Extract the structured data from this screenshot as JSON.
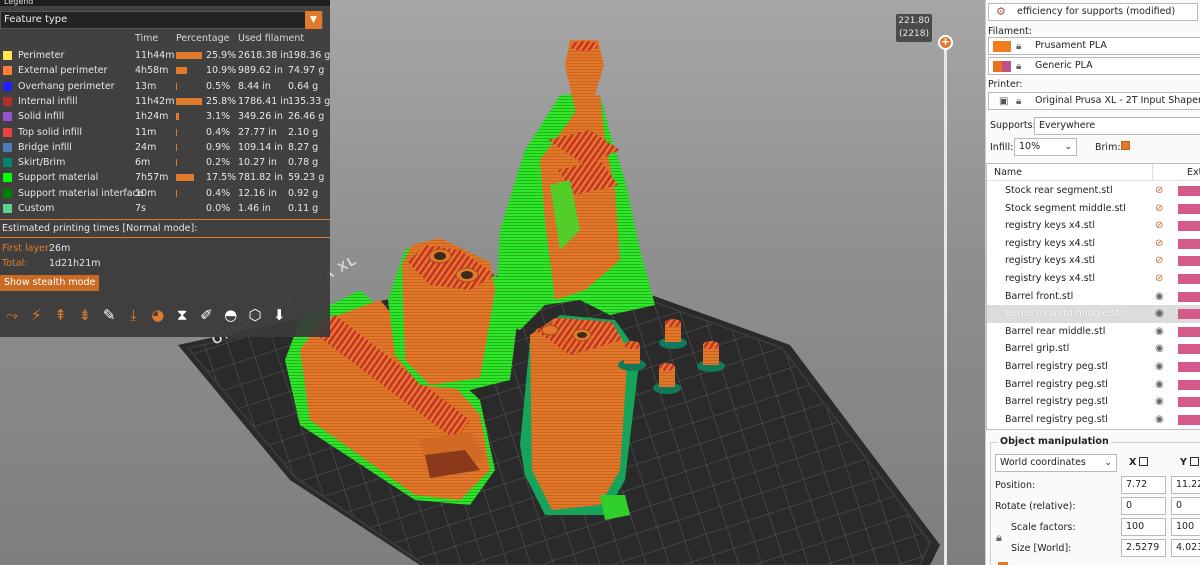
{
  "legend": {
    "title": "Legend",
    "view_type": "Feature type",
    "headers": {
      "time": "Time",
      "percentage": "Percentage",
      "used_filament": "Used filament"
    },
    "rows": [
      {
        "name": "Perimeter",
        "color": "#ffe64d",
        "time": "11h44m",
        "pct": "25.9%",
        "pct_value": 25.9,
        "length": "2618.38 in",
        "weight": "198.36 g"
      },
      {
        "name": "External perimeter",
        "color": "#ff7d38",
        "time": "4h58m",
        "pct": "10.9%",
        "pct_value": 10.9,
        "length": "989.62 in",
        "weight": "74.97 g"
      },
      {
        "name": "Overhang perimeter",
        "color": "#1f1fff",
        "time": "13m",
        "pct": "0.5%",
        "pct_value": 0.5,
        "length": "8.44 in",
        "weight": "0.64 g"
      },
      {
        "name": "Internal infill",
        "color": "#b03029",
        "time": "11h42m",
        "pct": "25.8%",
        "pct_value": 25.8,
        "length": "1786.41 in",
        "weight": "135.33 g"
      },
      {
        "name": "Solid infill",
        "color": "#9654cc",
        "time": "1h24m",
        "pct": "3.1%",
        "pct_value": 3.1,
        "length": "349.26 in",
        "weight": "26.46 g"
      },
      {
        "name": "Top solid infill",
        "color": "#f04040",
        "time": "11m",
        "pct": "0.4%",
        "pct_value": 0.4,
        "length": "27.77 in",
        "weight": "2.10 g"
      },
      {
        "name": "Bridge infill",
        "color": "#4d80ba",
        "time": "24m",
        "pct": "0.9%",
        "pct_value": 0.9,
        "length": "109.14 in",
        "weight": "8.27 g"
      },
      {
        "name": "Skirt/Brim",
        "color": "#00876e",
        "time": "6m",
        "pct": "0.2%",
        "pct_value": 0.2,
        "length": "10.27 in",
        "weight": "0.78 g"
      },
      {
        "name": "Support material",
        "color": "#00ff00",
        "time": "7h57m",
        "pct": "17.5%",
        "pct_value": 17.5,
        "length": "781.82 in",
        "weight": "59.23 g"
      },
      {
        "name": "Support material interface",
        "color": "#008000",
        "time": "10m",
        "pct": "0.4%",
        "pct_value": 0.4,
        "length": "12.16 in",
        "weight": "0.92 g"
      },
      {
        "name": "Custom",
        "color": "#5ed194",
        "time": "7s",
        "pct": "0.0%",
        "pct_value": 0.0,
        "length": "1.46 in",
        "weight": "0.11 g"
      }
    ],
    "estimated_label": "Estimated printing times [Normal mode]:",
    "first_layer_label": "First layer:",
    "first_layer_value": "26m",
    "total_label": "Total:",
    "total_value": "1d21h21m",
    "stealth_button": "Show stealth mode",
    "toolbar_icons": [
      "travel-icon",
      "wipe-icon",
      "retractions-icon",
      "deretractions-icon",
      "seams-icon",
      "tool-changes-icon",
      "color-changes-icon",
      "pause-icon",
      "custom-gcode-icon",
      "center-of-gravity-icon",
      "shells-icon",
      "tool-marker-icon"
    ]
  },
  "slider": {
    "height_value": "221.80",
    "layer_value": "(2218)",
    "thumb_symbol": "+"
  },
  "bed_label": "ORIGINAL PRUSA XL",
  "sidebar": {
    "print_settings": "efficiency for supports (modified)",
    "filament_label": "Filament:",
    "filaments": [
      {
        "name": "Prusament PLA",
        "color": "#f07d1e"
      },
      {
        "name": "Generic PLA",
        "color": "#e6721e",
        "accent": "#c0508a"
      }
    ],
    "printer_label": "Printer:",
    "printer": "Original Prusa XL - 2T Input Shaper 0.4 n",
    "supports_label": "Supports:",
    "supports_value": "Everywhere",
    "infill_label": "Infill:",
    "infill_value": "10%",
    "brim_label": "Brim:",
    "object_list": {
      "header_name": "Name",
      "header_extruder": "Ext",
      "items": [
        {
          "name": "Stock rear segment.stl",
          "visible": false
        },
        {
          "name": "Stock segment middle.stl",
          "visible": false
        },
        {
          "name": "registry keys x4.stl",
          "visible": false
        },
        {
          "name": "registry keys x4.stl",
          "visible": false
        },
        {
          "name": "registry keys x4.stl",
          "visible": false
        },
        {
          "name": "registry keys x4.stl",
          "visible": false
        },
        {
          "name": "Barrel front.stl",
          "visible": true
        },
        {
          "name": "Barrel forward middle.stl",
          "visible": true,
          "selected": true
        },
        {
          "name": "Barrel rear middle.stl",
          "visible": true
        },
        {
          "name": "Barrel grip.stl",
          "visible": true
        },
        {
          "name": "Barrel registry peg.stl",
          "visible": true
        },
        {
          "name": "Barrel registry peg.stl",
          "visible": true
        },
        {
          "name": "Barrel registry peg.stl",
          "visible": true
        },
        {
          "name": "Barrel registry peg.stl",
          "visible": true
        }
      ]
    },
    "object_manipulation": {
      "title": "Object manipulation",
      "coord_system": "World coordinates",
      "axis_x": "X",
      "axis_y": "Y",
      "position_label": "Position:",
      "position_x": "7.72",
      "position_y": "11.22",
      "rotate_label": "Rotate (relative):",
      "rotate_x": "0",
      "rotate_y": "0",
      "scale_label": "Scale factors:",
      "scale_x": "100",
      "scale_y": "100",
      "size_label": "Size [World]:",
      "size_x": "2.5279",
      "size_y": "4.02331"
    }
  }
}
